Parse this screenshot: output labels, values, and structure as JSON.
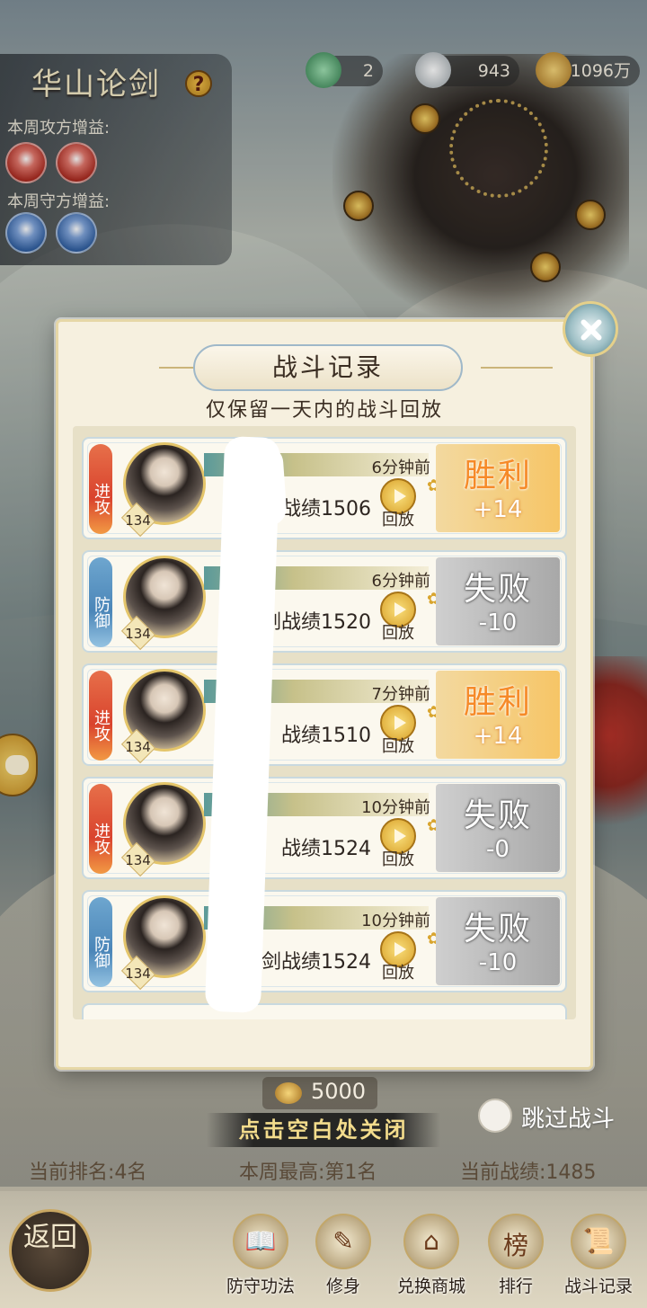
{
  "event": {
    "title": "华山论剑",
    "attack_buff_label": "本周攻方增益:",
    "defend_buff_label": "本周守方增益:"
  },
  "currency": {
    "jade": "2",
    "silver": "943",
    "copper": "1096万"
  },
  "modal": {
    "title": "战斗记录",
    "subtitle": "仅保留一天内的战斗回放",
    "replay_label": "回放",
    "records": [
      {
        "side": "进攻",
        "side_type": "attack",
        "level": "134",
        "time": "6分钟前",
        "score_label": "论剑战绩1506",
        "score_visible": "战绩1506",
        "result": "胜利",
        "delta": "+14"
      },
      {
        "side": "防御",
        "side_type": "defend",
        "level": "134",
        "time": "6分钟前",
        "score_label": "论剑战绩1520",
        "score_visible": "剑战绩1520",
        "result": "失败",
        "delta": "-10"
      },
      {
        "side": "进攻",
        "side_type": "attack",
        "level": "134",
        "time": "7分钟前",
        "score_label": "论剑战绩1510",
        "score_visible": "战绩1510",
        "result": "胜利",
        "delta": "+14"
      },
      {
        "side": "进攻",
        "side_type": "attack",
        "level": "134",
        "time": "10分钟前",
        "score_label": "论剑战绩1524",
        "score_visible": "战绩1524",
        "result": "失败",
        "delta": "-0"
      },
      {
        "side": "防御",
        "side_type": "defend",
        "level": "134",
        "time": "10分钟前",
        "score_label": "论剑战绩1524",
        "score_visible": "论剑战绩1524",
        "result": "失败",
        "delta": "-10"
      }
    ]
  },
  "footer": {
    "coin_value": "5000",
    "tap_hint": "点击空白处关闭",
    "skip_battle": "跳过战斗",
    "current_rank": "当前排名:4名",
    "weekly_best": "本周最高:第1名",
    "current_score": "当前战绩:1485"
  },
  "nav": {
    "back": "返回",
    "items": [
      {
        "label": "防守功法",
        "icon": "scroll-book-icon"
      },
      {
        "label": "修身",
        "icon": "brush-book-icon"
      },
      {
        "label": "兑换商城",
        "icon": "shop-pavilion-icon"
      },
      {
        "label": "排行",
        "icon": "ranking-banner-icon"
      },
      {
        "label": "战斗记录",
        "icon": "battle-scroll-icon"
      }
    ]
  },
  "colors": {
    "win": "#f68a28",
    "lose": "#a8a8a8",
    "attack_tag": "#d9432d",
    "defend_tag": "#4b86b8",
    "gold_trim": "#e4c56a"
  }
}
